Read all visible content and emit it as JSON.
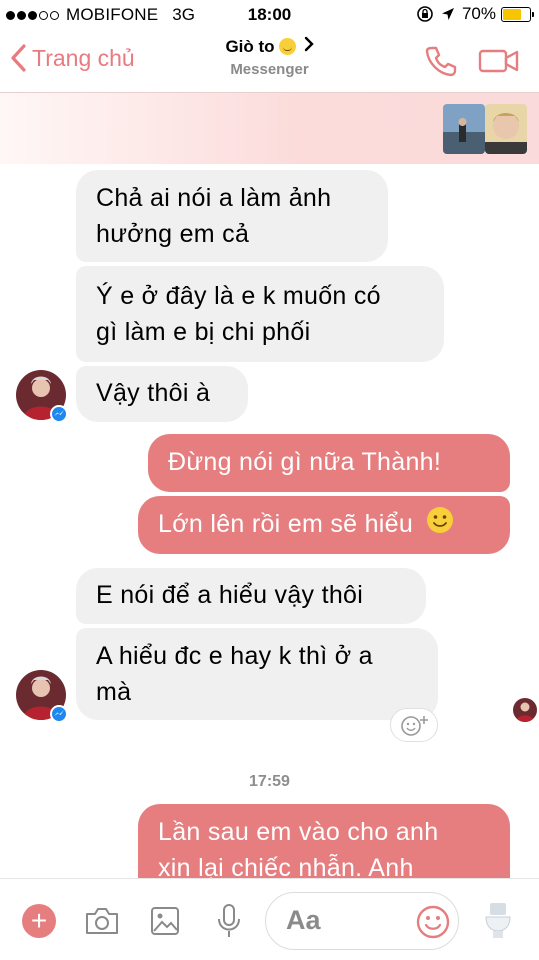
{
  "status_bar": {
    "carrier": "MOBIFONE",
    "network": "3G",
    "time": "18:00",
    "battery": "70%",
    "battery_level": 0.7
  },
  "header": {
    "back_label": "Trang chủ",
    "contact_name": "Giò to",
    "subtitle": "Messenger",
    "icons": [
      "chevron-left-icon",
      "chevron-right-icon",
      "phone-icon",
      "video-camera-icon"
    ]
  },
  "messages": [
    {
      "side": "incoming",
      "lines": [
        "Chả ai nói a làm ảnh",
        "hưởng em cả"
      ]
    },
    {
      "side": "incoming",
      "lines": [
        "Ý e ở đây là e k muốn có",
        "gì làm e bị chi phối"
      ]
    },
    {
      "side": "incoming",
      "lines": [
        "Vậy thôi à"
      ]
    },
    {
      "side": "outgoing",
      "lines": [
        "Đừng nói gì nữa Thành!"
      ]
    },
    {
      "side": "outgoing",
      "lines": [
        "Lớn lên rồi em sẽ hiểu"
      ]
    },
    {
      "side": "incoming",
      "lines": [
        "E nói để a hiểu vậy thôi"
      ]
    },
    {
      "side": "incoming",
      "lines": [
        "A hiểu đc e hay k thì ở a",
        "mà"
      ]
    },
    {
      "side": "outgoing",
      "lines": [
        "Lần sau em vào cho anh",
        "xin lại chiếc nhẫn. Anh"
      ]
    }
  ],
  "timestamp": "17:59",
  "composer": {
    "placeholder": "Aa",
    "icons": [
      "plus-icon",
      "camera-icon",
      "image-icon",
      "microphone-icon",
      "emoji-icon",
      "toilet-sticker-icon"
    ]
  },
  "colors": {
    "accent": "#e67e80",
    "incoming_bubble": "#f1f0f0",
    "messenger_badge": "#1e88f0"
  }
}
